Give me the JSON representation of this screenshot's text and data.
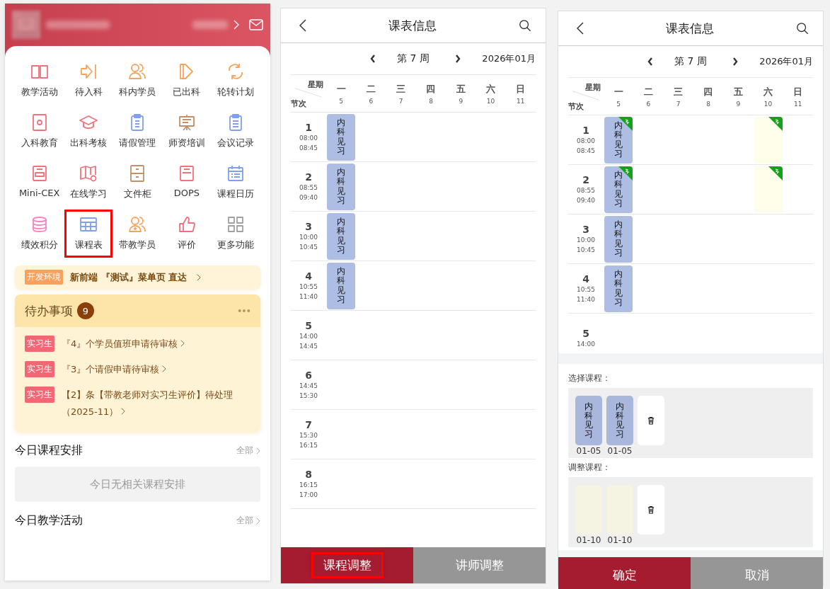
{
  "home": {
    "menu": [
      {
        "label": "教学活动",
        "color": "#f0727c",
        "highlighted": false
      },
      {
        "label": "待入科",
        "color": "#f5a45d",
        "highlighted": false
      },
      {
        "label": "科内学员",
        "color": "#f5a45d",
        "highlighted": false
      },
      {
        "label": "已出科",
        "color": "#f5a45d",
        "highlighted": false
      },
      {
        "label": "轮转计划",
        "color": "#f5a45d",
        "highlighted": false
      },
      {
        "label": "入科教育",
        "color": "#f0727c",
        "highlighted": false
      },
      {
        "label": "出科考核",
        "color": "#f0727c",
        "highlighted": false
      },
      {
        "label": "请假管理",
        "color": "#7f9ff0",
        "highlighted": false
      },
      {
        "label": "师资培训",
        "color": "#c4906a",
        "highlighted": false
      },
      {
        "label": "会议记录",
        "color": "#7f9ff0",
        "highlighted": false
      },
      {
        "label": "Mini-CEX",
        "color": "#f0727c",
        "highlighted": false
      },
      {
        "label": "在线学习",
        "color": "#f0727c",
        "highlighted": false
      },
      {
        "label": "文件柜",
        "color": "#c4906a",
        "highlighted": false
      },
      {
        "label": "DOPS",
        "color": "#f0727c",
        "highlighted": false
      },
      {
        "label": "课程日历",
        "color": "#7f9ff0",
        "highlighted": false
      },
      {
        "label": "绩效积分",
        "color": "#f684c0",
        "highlighted": false
      },
      {
        "label": "课程表",
        "color": "#7f9ff0",
        "highlighted": true
      },
      {
        "label": "带教学员",
        "color": "#f5a45d",
        "highlighted": false
      },
      {
        "label": "评价",
        "color": "#f0727c",
        "highlighted": false
      },
      {
        "label": "更多功能",
        "color": "#a0a0a0",
        "highlighted": false
      }
    ],
    "banner": {
      "tag": "开发环境",
      "text": "新前端 『测试』菜单页 直达"
    },
    "todo": {
      "title": "待办事项",
      "count": "9",
      "items": [
        {
          "tag": "实习生",
          "text": "『4』个学员值班申请待审核"
        },
        {
          "tag": "实习生",
          "text": "『3』个请假申请待审核"
        },
        {
          "tag": "实习生",
          "text": "【2】条【带教老师对实习生评价】待处理（2025-11）"
        }
      ]
    },
    "sections": [
      {
        "title": "今日课程安排",
        "link": "全部",
        "empty": "今日无相关课程安排"
      },
      {
        "title": "今日教学活动",
        "link": "全部"
      }
    ]
  },
  "schedule_screen": {
    "title": "课表信息",
    "week": "第 7 周",
    "month": "2026年01月",
    "corner": {
      "top": "星期",
      "bottom": "节次"
    },
    "days": [
      {
        "name": "一",
        "date": "5"
      },
      {
        "name": "二",
        "date": "6"
      },
      {
        "name": "三",
        "date": "7"
      },
      {
        "name": "四",
        "date": "8"
      },
      {
        "name": "五",
        "date": "9"
      },
      {
        "name": "六",
        "date": "10"
      },
      {
        "name": "日",
        "date": "11"
      }
    ],
    "periods": [
      {
        "num": "1",
        "start": "08:00",
        "end": "08:45",
        "slots": [
          {
            "kind": "course",
            "name": "内科见习",
            "tagged": false
          }
        ]
      },
      {
        "num": "2",
        "start": "08:55",
        "end": "09:40",
        "slots": [
          {
            "kind": "course",
            "name": "内科见习",
            "tagged": false
          }
        ]
      },
      {
        "num": "3",
        "start": "10:00",
        "end": "10:45",
        "slots": [
          {
            "kind": "course",
            "name": "内科见习",
            "tagged": false
          }
        ]
      },
      {
        "num": "4",
        "start": "10:55",
        "end": "11:40",
        "slots": [
          {
            "kind": "course",
            "name": "内科见习",
            "tagged": false
          }
        ]
      },
      {
        "num": "5",
        "start": "14:00",
        "end": "14:45"
      },
      {
        "num": "6",
        "start": "14:45",
        "end": "15:30"
      },
      {
        "num": "7",
        "start": "15:30",
        "end": "16:15"
      },
      {
        "num": "8",
        "start": "16:15",
        "end": "17:00"
      }
    ],
    "buttons": [
      {
        "label": "课程调整",
        "kind": "primary",
        "highlighted": true
      },
      {
        "label": "讲师调整",
        "kind": "secondary",
        "highlighted": false
      }
    ]
  },
  "adjust_screen": {
    "title": "课表信息",
    "week": "第 7 周",
    "month": "2026年01月",
    "corner": {
      "top": "星期",
      "bottom": "节次"
    },
    "days": [
      {
        "name": "一",
        "date": "5"
      },
      {
        "name": "二",
        "date": "6"
      },
      {
        "name": "三",
        "date": "7"
      },
      {
        "name": "四",
        "date": "8"
      },
      {
        "name": "五",
        "date": "9"
      },
      {
        "name": "六",
        "date": "10"
      },
      {
        "name": "日",
        "date": "11"
      }
    ],
    "periods": [
      {
        "num": "1",
        "start": "08:00",
        "end": "08:45",
        "slots": [
          {
            "kind": "course",
            "name": "内科见习",
            "tagged": true
          },
          {
            "kind": "empty"
          },
          {
            "kind": "empty"
          },
          {
            "kind": "empty"
          },
          {
            "kind": "empty"
          },
          {
            "kind": "target",
            "tagged": true
          }
        ]
      },
      {
        "num": "2",
        "start": "08:55",
        "end": "09:40",
        "slots": [
          {
            "kind": "course",
            "name": "内科见习",
            "tagged": true
          },
          {
            "kind": "empty"
          },
          {
            "kind": "empty"
          },
          {
            "kind": "empty"
          },
          {
            "kind": "empty"
          },
          {
            "kind": "target",
            "tagged": true
          }
        ]
      },
      {
        "num": "3",
        "start": "10:00",
        "end": "10:45",
        "slots": [
          {
            "kind": "course",
            "name": "内科见习",
            "tagged": false
          }
        ]
      },
      {
        "num": "4",
        "start": "10:55",
        "end": "11:40",
        "slots": [
          {
            "kind": "course",
            "name": "内科见习",
            "tagged": false
          }
        ]
      },
      {
        "num": "5",
        "start": "14:00"
      }
    ],
    "adjust": [
      {
        "label": "选择课程：",
        "chips": [
          {
            "kind": "course",
            "name": "内科见习",
            "date": "01-05"
          },
          {
            "kind": "course",
            "name": "内科见习",
            "date": "01-05"
          }
        ]
      },
      {
        "label": "调整课程：",
        "chips": [
          {
            "kind": "target",
            "date": "01-10"
          },
          {
            "kind": "target",
            "date": "01-10"
          }
        ]
      }
    ],
    "buttons": [
      {
        "label": "确定",
        "kind": "primary",
        "highlighted": false
      },
      {
        "label": "取消",
        "kind": "secondary",
        "highlighted": false
      }
    ]
  }
}
